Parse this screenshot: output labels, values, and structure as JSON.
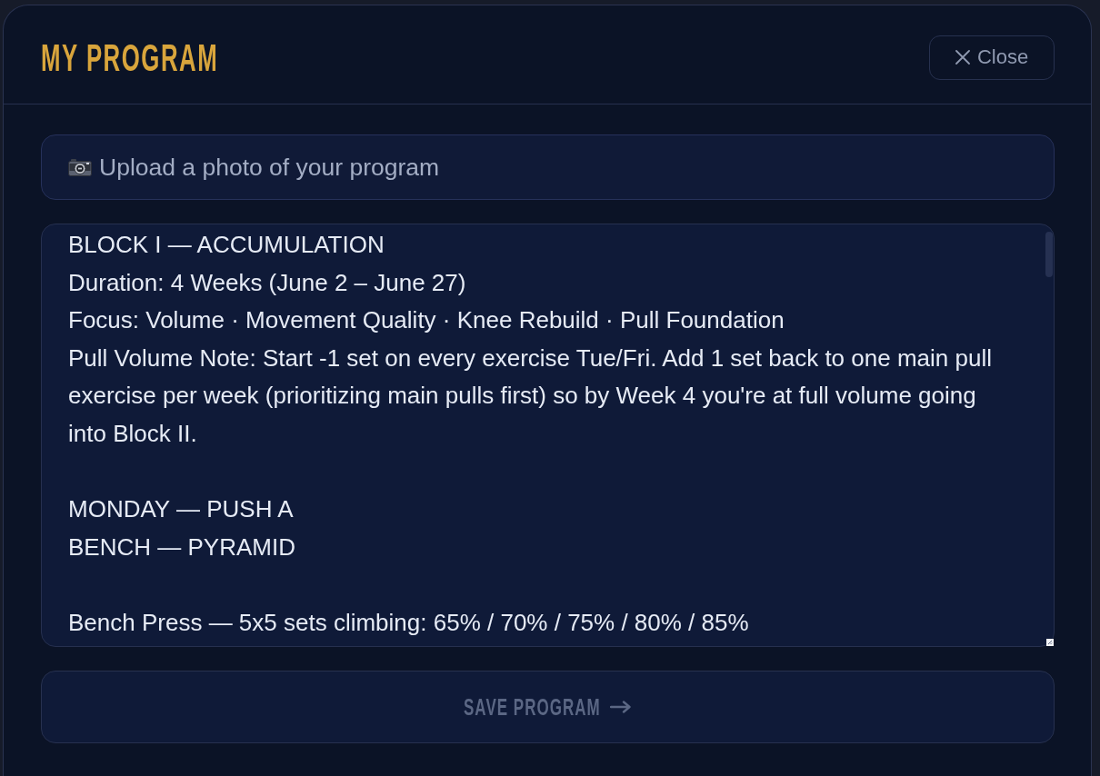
{
  "dialog": {
    "title": "MY PROGRAM",
    "close_button": {
      "label": "Close"
    }
  },
  "upload_button": {
    "label": "Upload a photo of your program"
  },
  "program_text": {
    "value": "BLOCK I — ACCUMULATION\nDuration: 4 Weeks (June 2 – June 27)\nFocus: Volume · Movement Quality · Knee Rebuild · Pull Foundation\nPull Volume Note: Start -1 set on every exercise Tue/Fri. Add 1 set back to one main pull exercise per week (prioritizing main pulls first) so by Week 4 you're at full volume going into Block II.\n\nMONDAY — PUSH A\nBENCH — PYRAMID\n\nBench Press — 5x5 sets climbing: 65% / 70% / 75% / 80% / 85%"
  },
  "save_button": {
    "label": "SAVE PROGRAM",
    "disabled": true
  }
}
